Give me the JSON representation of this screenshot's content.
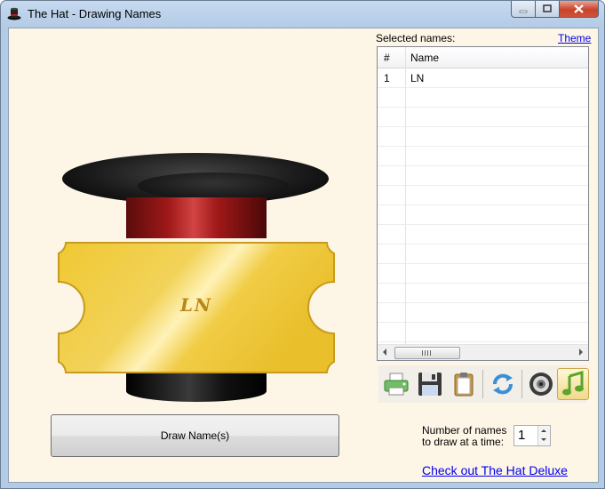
{
  "window": {
    "title": "The Hat - Drawing Names"
  },
  "hat": {
    "ticket_name": "LN"
  },
  "draw_button": {
    "label": "Draw Name(s)"
  },
  "selected": {
    "label": "Selected names:",
    "theme_link": "Theme",
    "columns": [
      "#",
      "Name"
    ],
    "rows": [
      {
        "num": "1",
        "name": "LN"
      }
    ],
    "scroll_grip": "III"
  },
  "toolbar": {
    "icons": [
      "print-icon",
      "save-icon",
      "clipboard-icon",
      "refresh-icon",
      "speaker-icon",
      "music-note-icon"
    ],
    "active": "music-note-icon"
  },
  "count": {
    "label_line1": "Number of names",
    "label_line2": "to draw at a time:",
    "value": "1"
  },
  "deluxe_link": "Check out The Hat Deluxe"
}
